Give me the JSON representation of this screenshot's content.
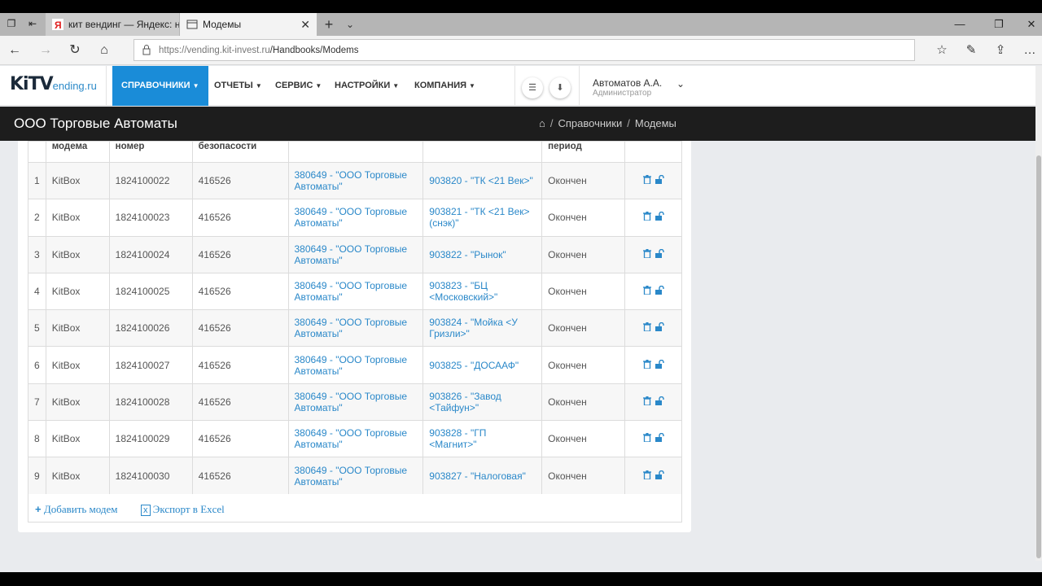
{
  "browser": {
    "tabs": [
      {
        "label": "кит вендинг — Яндекс: наі",
        "active": false
      },
      {
        "label": "Модемы",
        "active": true
      }
    ],
    "url_host": "https://vending.kit-invest.ru",
    "url_path": "/Handbooks/Modems"
  },
  "app": {
    "logo_main": "KiTV",
    "logo_sub": "ending.ru",
    "menu": [
      {
        "label": "СПРАВОЧНИКИ",
        "active": true
      },
      {
        "label": "ОТЧЕТЫ",
        "active": false
      },
      {
        "label": "СЕРВИС",
        "active": false
      },
      {
        "label": "НАСТРОЙКИ",
        "active": false
      },
      {
        "label": "КОМПАНИЯ",
        "active": false
      }
    ],
    "user_name": "Автоматов А.А.",
    "user_role": "Администратор"
  },
  "titlebar": {
    "organization": "ООО Торговые Автоматы",
    "breadcrumbs": [
      "Справочники",
      "Модемы"
    ]
  },
  "table": {
    "headers": [
      "",
      "модема",
      "номер",
      "безопасости",
      "",
      "",
      "период",
      ""
    ],
    "rows": [
      {
        "n": "1",
        "model": "KitBox",
        "number": "1824100022",
        "security": "416526",
        "owner": "380649 - \"ООО Торговые Автоматы\"",
        "machine": "903820 - \"ТК <21 Век>\"",
        "status": "Окончен"
      },
      {
        "n": "2",
        "model": "KitBox",
        "number": "1824100023",
        "security": "416526",
        "owner": "380649 - \"ООО Торговые Автоматы\"",
        "machine": "903821 - \"ТК <21 Век> (снэк)\"",
        "status": "Окончен"
      },
      {
        "n": "3",
        "model": "KitBox",
        "number": "1824100024",
        "security": "416526",
        "owner": "380649 - \"ООО Торговые Автоматы\"",
        "machine": "903822 - \"Рынок\"",
        "status": "Окончен"
      },
      {
        "n": "4",
        "model": "KitBox",
        "number": "1824100025",
        "security": "416526",
        "owner": "380649 - \"ООО Торговые Автоматы\"",
        "machine": "903823 - \"БЦ <Московский>\"",
        "status": "Окончен"
      },
      {
        "n": "5",
        "model": "KitBox",
        "number": "1824100026",
        "security": "416526",
        "owner": "380649 - \"ООО Торговые Автоматы\"",
        "machine": "903824 - \"Мойка <У Гризли>\"",
        "status": "Окончен"
      },
      {
        "n": "6",
        "model": "KitBox",
        "number": "1824100027",
        "security": "416526",
        "owner": "380649 - \"ООО Торговые Автоматы\"",
        "machine": "903825 - \"ДОСААФ\"",
        "status": "Окончен"
      },
      {
        "n": "7",
        "model": "KitBox",
        "number": "1824100028",
        "security": "416526",
        "owner": "380649 - \"ООО Торговые Автоматы\"",
        "machine": "903826 - \"Завод <Тайфун>\"",
        "status": "Окончен"
      },
      {
        "n": "8",
        "model": "KitBox",
        "number": "1824100029",
        "security": "416526",
        "owner": "380649 - \"ООО Торговые Автоматы\"",
        "machine": "903828 - \"ГП <Магнит>\"",
        "status": "Окончен"
      },
      {
        "n": "9",
        "model": "KitBox",
        "number": "1824100030",
        "security": "416526",
        "owner": "380649 - \"ООО Торговые Автоматы\"",
        "machine": "903827 - \"Налоговая\"",
        "status": "Окончен"
      }
    ]
  },
  "footer": {
    "add_label": "Добавить модем",
    "export_label": "Экспорт в Excel"
  },
  "colors": {
    "accent": "#1a8cd8",
    "link": "#2a88c9",
    "titlebar": "#1d1d1d"
  }
}
